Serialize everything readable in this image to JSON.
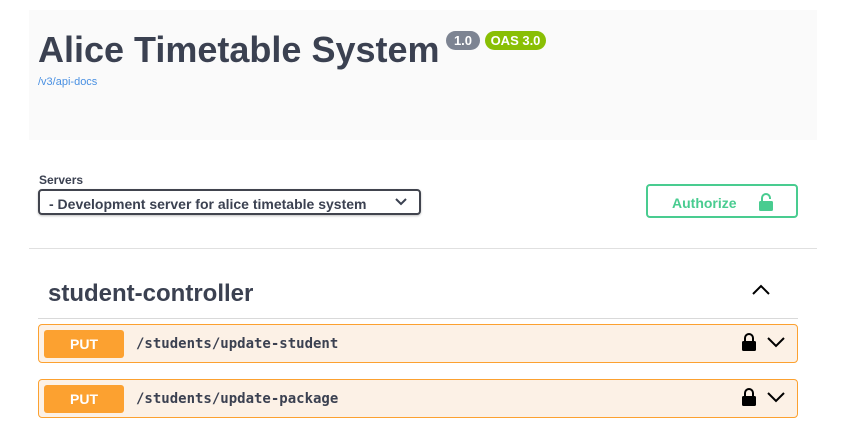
{
  "info": {
    "title": "Alice Timetable System",
    "version_badge": "1.0",
    "oas_badge": "OAS 3.0",
    "api_docs_link": "/v3/api-docs"
  },
  "servers": {
    "label": "Servers",
    "selected": "- Development server for alice timetable system"
  },
  "authorize": {
    "label": "Authorize",
    "color": "#49cc90"
  },
  "tag": {
    "name": "student-controller",
    "expanded": true
  },
  "operations": [
    {
      "method": "PUT",
      "path": "/students/update-student",
      "color": "#fca130"
    },
    {
      "method": "PUT",
      "path": "/students/update-package",
      "color": "#fca130"
    }
  ]
}
